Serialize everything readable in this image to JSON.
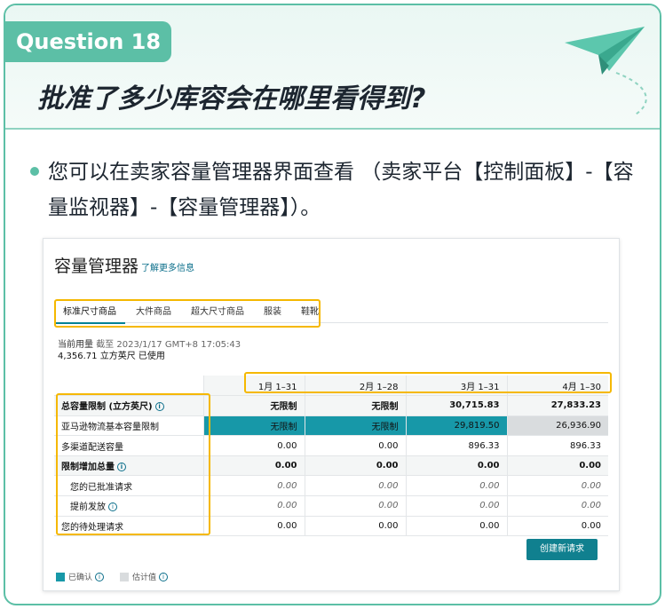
{
  "question": {
    "badge": "Question 18",
    "title": "批准了多少库容会在哪里看得到?"
  },
  "bullet": {
    "text": "您可以在卖家容量管理器界面查看 （卖家平台【控制面板】-【容量监视器】-【容量管理器】）。"
  },
  "panel": {
    "title": "容量管理器",
    "learn_more": "了解更多信息",
    "tabs": [
      "标准尺寸商品",
      "大件商品",
      "超大尺寸商品",
      "服装",
      "鞋靴"
    ],
    "usage": {
      "label": "当前用量",
      "as_of": "截至 2023/1/17 GMT+8 17:05:43",
      "value": "4,356.71 立方英尺 已使用"
    },
    "columns": [
      "1月 1–31",
      "2月 1–28",
      "3月 1–31",
      "4月 1–30"
    ],
    "rows": [
      {
        "label": "总容量限制 (立方英尺)",
        "info": true,
        "values": [
          "无限制",
          "无限制",
          "30,715.83",
          "27,833.23"
        ]
      },
      {
        "label": "亚马逊物流基本容量限制",
        "info": false,
        "values": [
          "无限制",
          "无限制",
          "29,819.50",
          "26,936.90"
        ]
      },
      {
        "label": "多渠道配送容量",
        "info": false,
        "values": [
          "0.00",
          "0.00",
          "896.33",
          "896.33"
        ]
      },
      {
        "label": "限制增加总量",
        "info": true,
        "values": [
          "0.00",
          "0.00",
          "0.00",
          "0.00"
        ]
      },
      {
        "label": "您的已批准请求",
        "info": false,
        "values": [
          "0.00",
          "0.00",
          "0.00",
          "0.00"
        ]
      },
      {
        "label": "提前发放",
        "info": true,
        "values": [
          "0.00",
          "0.00",
          "0.00",
          "0.00"
        ]
      },
      {
        "label": "您的待处理请求",
        "info": false,
        "values": [
          "0.00",
          "0.00",
          "0.00",
          "0.00"
        ]
      }
    ],
    "new_request_button": "创建新请求",
    "legend": {
      "confirmed": "已确认",
      "estimated": "估计值"
    },
    "info_glyph": "i",
    "colors": {
      "accent": "#5cbfa6",
      "teal": "#1798a8",
      "highlight": "#f5b800",
      "estimate": "#d9dcde"
    }
  }
}
